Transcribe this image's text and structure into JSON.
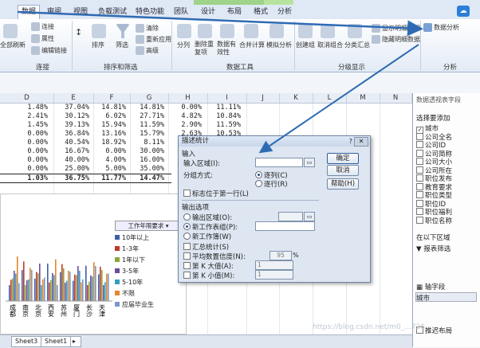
{
  "ribbon": {
    "tabs": [
      "数据",
      "审阅",
      "视图",
      "负载测试",
      "特色功能",
      "团队",
      "设计",
      "布局",
      "格式",
      "分析"
    ],
    "buttons": {
      "b1": "全部刷新",
      "b2": "连接",
      "b3": "属性",
      "b4": "编辑链接",
      "b5": "排序",
      "b6": "筛选",
      "b7": "清除",
      "b8": "重新应用",
      "b9": "高级",
      "b10": "分列",
      "b11": "删除重复项",
      "b12": "数据有效性",
      "b13": "合并计算",
      "b14": "模拟分析",
      "b15": "创建组",
      "b16": "取消组合",
      "b17": "分类汇总",
      "b18": "显示明细数据",
      "b19": "隐藏明细数据",
      "b20": "数据分析"
    },
    "groups": [
      "连接",
      "排序和筛选",
      "数据工具",
      "分级显示",
      "分析"
    ]
  },
  "grid": {
    "columns": [
      "D",
      "E",
      "F",
      "G",
      "H",
      "I",
      "J",
      "K",
      "L",
      "M",
      "N"
    ],
    "rows": [
      [
        "1.48%",
        "37.04%",
        "14.81%",
        "14.81%",
        "0.00%",
        "11.11%"
      ],
      [
        "2.41%",
        "30.12%",
        "6.02%",
        "27.71%",
        "4.82%",
        "10.84%"
      ],
      [
        "1.45%",
        "39.13%",
        "15.94%",
        "11.59%",
        "2.90%",
        "11.59%"
      ],
      [
        "0.00%",
        "36.84%",
        "13.16%",
        "15.79%",
        "2.63%",
        "10.53%"
      ],
      [
        "0.00%",
        "40.54%",
        "18.92%",
        "8.11%",
        "5.41%",
        "10.81%"
      ],
      [
        "0.00%",
        "16.67%",
        "0.00%",
        "30.00%",
        "0.00%",
        "20.00%"
      ],
      [
        "0.00%",
        "40.00%",
        "4.00%",
        "16.00%",
        "0.00%",
        "20.00%"
      ],
      [
        "0.00%",
        "25.00%",
        "5.00%",
        "35.00%",
        "0.00%",
        "15.00%"
      ],
      [
        "1.03%",
        "36.75%",
        "11.77%",
        "14.47%",
        "",
        ""
      ]
    ]
  },
  "chart": {
    "filter_label": "工作年限要求 ▾",
    "legend": [
      {
        "name": "10年以上",
        "color": "#3d5fa8"
      },
      {
        "name": "1-3年",
        "color": "#c0392b"
      },
      {
        "name": "1年以下",
        "color": "#8aa63b"
      },
      {
        "name": "3-5年",
        "color": "#6c4c9a"
      },
      {
        "name": "5-10年",
        "color": "#2fa0c0"
      },
      {
        "name": "不限",
        "color": "#e3872b"
      },
      {
        "name": "应届毕业生",
        "color": "#7b97cc"
      }
    ],
    "categories": [
      "成都",
      "南京",
      "北京",
      "西安",
      "苏州",
      "厦门",
      "长沙",
      "天津"
    ]
  },
  "sheets": [
    "Sheet3",
    "Sheet1"
  ],
  "pivot": {
    "title": "数据透视表字段",
    "choose": "选择要添加",
    "fields": [
      {
        "label": "城市",
        "checked": true
      },
      {
        "label": "公司全名",
        "checked": false
      },
      {
        "label": "公司ID",
        "checked": false
      },
      {
        "label": "公司简称",
        "checked": false
      },
      {
        "label": "公司大小",
        "checked": false
      },
      {
        "label": "公司所在",
        "checked": false
      },
      {
        "label": "职位发布",
        "checked": false
      },
      {
        "label": "教育要求",
        "checked": false
      },
      {
        "label": "职位类型",
        "checked": false
      },
      {
        "label": "职位ID",
        "checked": false
      },
      {
        "label": "职位福利",
        "checked": false
      },
      {
        "label": "职位名称",
        "checked": false
      }
    ],
    "drag_hint": "在以下区域",
    "report_filter": "报表筛选",
    "axis_field": "轴字段",
    "axis_value": "城市",
    "defer": "推迟布局"
  },
  "dialog": {
    "title": "描述统计",
    "input_section": "输入",
    "input_range_label": "输入区域(I):",
    "group_label": "分组方式:",
    "by_col": "逐列(C)",
    "by_row": "逐行(R)",
    "first_row_label": "标志位于第一行(L)",
    "output_section": "输出选项",
    "output_range": "输出区域(O):",
    "new_sheet": "新工作表组(P):",
    "new_book": "新工作簿(W)",
    "summary": "汇总统计(S)",
    "confidence": "平均数置信度(N):",
    "confidence_value": "95",
    "confidence_unit": "%",
    "kth_large": "第 K 大值(A):",
    "kth_large_value": "1",
    "kth_small": "第 K 小值(M):",
    "kth_small_value": "1",
    "ok": "确定",
    "cancel": "取消",
    "help": "帮助(H)"
  },
  "watermark": "https://blog.csdn.net/m0_...726"
}
